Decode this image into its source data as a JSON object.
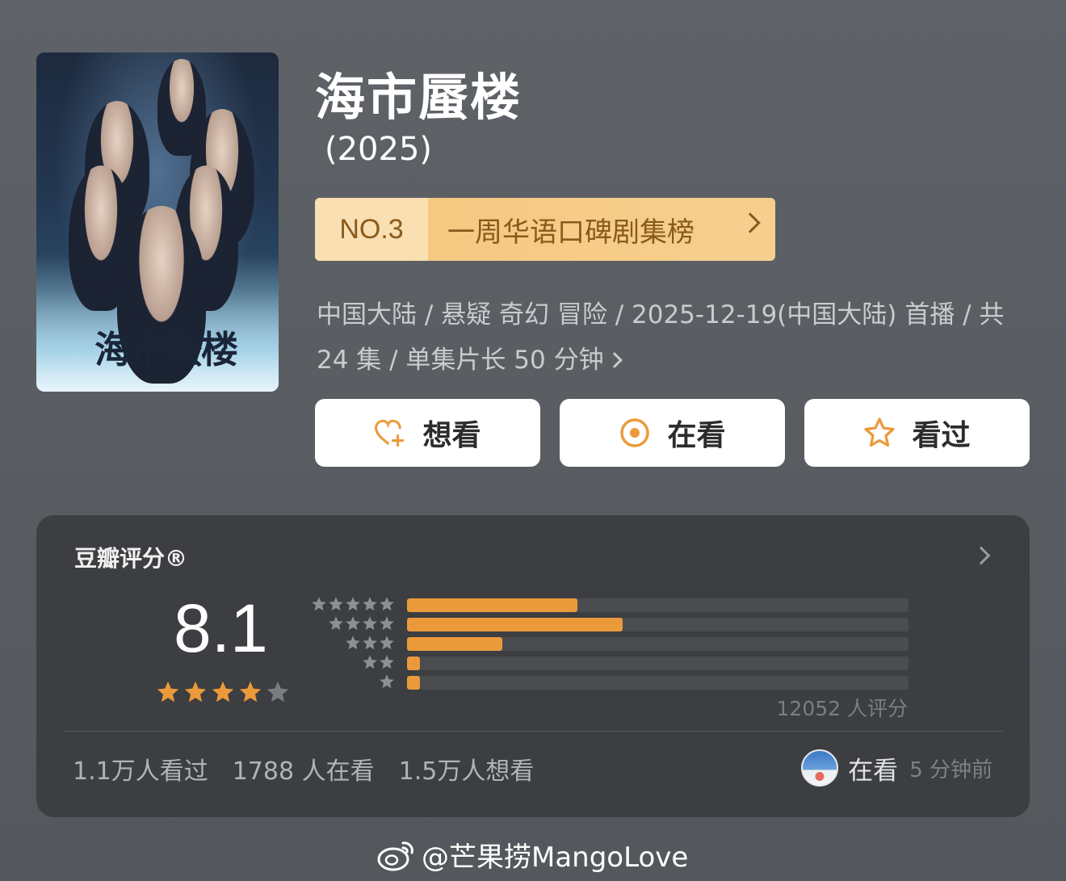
{
  "poster": {
    "title": "海市蜃楼"
  },
  "show": {
    "title": "海市蜃楼",
    "year": "(2025)",
    "rank_no": "NO.3",
    "rank_name": "一周华语口碑剧集榜",
    "meta_line1": "中国大陆 / 悬疑 奇幻 冒险 / 2025-12-19(中国大陆) 首播 / 共",
    "meta_line2": "24 集 / 单集片长 50 分钟"
  },
  "actions": {
    "want": "想看",
    "watching": "在看",
    "watched": "看过"
  },
  "rating": {
    "label": "豆瓣评分®",
    "score": "8.1",
    "stars": 4,
    "distribution": [
      {
        "stars": 5,
        "fraction": 0.34
      },
      {
        "stars": 4,
        "fraction": 0.43
      },
      {
        "stars": 3,
        "fraction": 0.19
      },
      {
        "stars": 2,
        "fraction": 0.025
      },
      {
        "stars": 1,
        "fraction": 0.025
      }
    ],
    "votes": "12052 人评分",
    "stat_watched": "1.1万人看过",
    "stat_watching": "1788 人在看",
    "stat_want": "1.5万人想看",
    "friend_status": "在看",
    "friend_time": "5 分钟前"
  },
  "watermark": "@芒果捞MangoLove",
  "colors": {
    "accent": "#eb9a3b",
    "badge": "#f5c77d",
    "badge_text": "#8a5a1c"
  }
}
